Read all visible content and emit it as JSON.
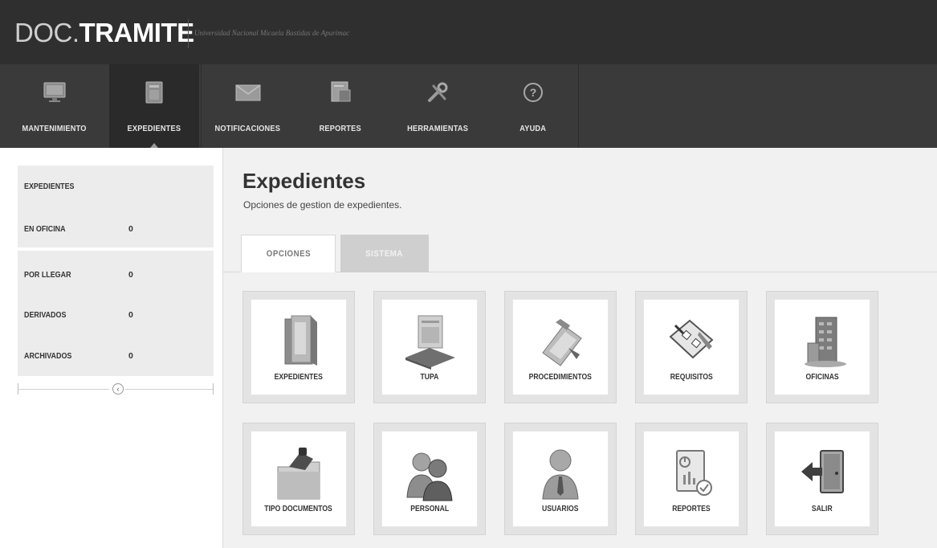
{
  "app": {
    "logo_light": "DOC.",
    "logo_bold": "TRAMITE",
    "org": "Universidad Nacional Micaela Bastidas de Apurimac"
  },
  "nav": {
    "items": [
      {
        "label": "MANTENIMIENTO",
        "icon": "monitor-icon"
      },
      {
        "label": "EXPEDIENTES",
        "icon": "folder-icon"
      },
      {
        "label": "NOTIFICACIONES",
        "icon": "envelope-icon"
      },
      {
        "label": "REPORTES",
        "icon": "report-icon"
      },
      {
        "label": "HERRAMIENTAS",
        "icon": "tools-icon"
      },
      {
        "label": "AYUDA",
        "icon": "help-icon"
      }
    ],
    "active": "EXPEDIENTES"
  },
  "sidebar": {
    "header": "EXPEDIENTES",
    "items": [
      {
        "label": "EN OFICINA",
        "value": "0"
      },
      {
        "label": "POR LLEGAR",
        "value": "0"
      },
      {
        "label": "DERIVADOS",
        "value": "0"
      },
      {
        "label": "ARCHIVADOS",
        "value": "0"
      }
    ],
    "collapse_icon": "chevron-left-icon"
  },
  "main": {
    "title": "Expedientes",
    "subtitle": "Opciones de gestion de expedientes.",
    "tabs": [
      {
        "label": "OPCIONES",
        "active": true
      },
      {
        "label": "SISTEMA",
        "active": false
      }
    ],
    "tiles": [
      {
        "label": "EXPEDIENTES",
        "icon": "binders-icon"
      },
      {
        "label": "TUPA",
        "icon": "document-stack-icon"
      },
      {
        "label": "PROCEDIMIENTOS",
        "icon": "clipboard-icon"
      },
      {
        "label": "REQUISITOS",
        "icon": "checklist-icon"
      },
      {
        "label": "OFICINAS",
        "icon": "building-icon"
      },
      {
        "label": "TIPO DOCUMENTOS",
        "icon": "folder-stamp-icon"
      },
      {
        "label": "PERSONAL",
        "icon": "people-icon"
      },
      {
        "label": "USUARIOS",
        "icon": "user-icon"
      },
      {
        "label": "REPORTES",
        "icon": "report-chart-icon"
      },
      {
        "label": "SALIR",
        "icon": "exit-door-icon"
      }
    ]
  },
  "colors": {
    "topbar": "#2f2f2f",
    "navbar": "#3a3a3a",
    "tab_inactive": "#cfcfcf"
  }
}
